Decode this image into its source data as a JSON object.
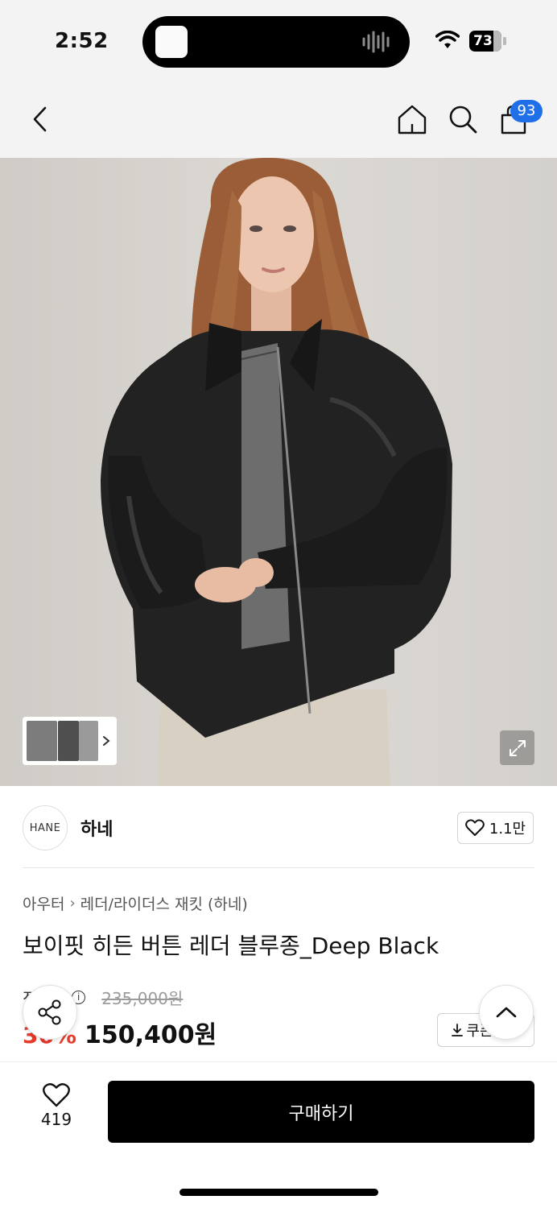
{
  "status_bar": {
    "time": "2:52",
    "battery": "73"
  },
  "nav": {
    "cart_count": "93"
  },
  "gallery": {
    "thumbs_label": "›"
  },
  "brand": {
    "logo_text": "HANE",
    "name": "하네",
    "likes": "1.1만"
  },
  "breadcrumb": [
    "아우터",
    "레더/라이더스 재킷 (하네)"
  ],
  "product": {
    "title": "보이핏 히든 버튼 레더 블루종_Deep Black",
    "original_label": "정상가",
    "original_price": "235,000원",
    "discount": "36%",
    "price": "150,400원",
    "coupon_label": "쿠폰받기"
  },
  "bottom": {
    "wish_count": "419",
    "buy_label": "구매하기"
  },
  "colors": {
    "accent_blue": "#1f6fe9",
    "discount_red": "#e53b2c",
    "buy_bg": "#000000"
  }
}
